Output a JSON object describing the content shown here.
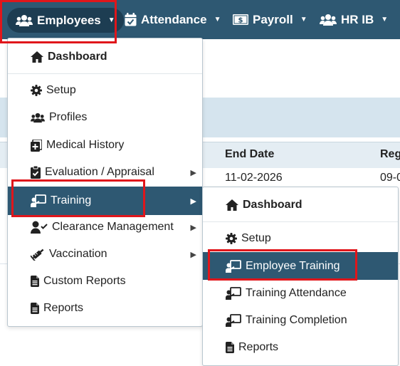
{
  "navbar": {
    "items": [
      {
        "label": "Employees",
        "icon": "users-icon"
      },
      {
        "label": "Attendance",
        "icon": "calendar-check-icon"
      },
      {
        "label": "Payroll",
        "icon": "money-bill-icon"
      },
      {
        "label": "HR IB",
        "icon": "users-icon"
      }
    ]
  },
  "background": {
    "columns": [
      "End Date",
      "Regi"
    ],
    "row": {
      "end_date": "11-02-2026",
      "regi": "09-0"
    }
  },
  "employees_menu": {
    "items": [
      {
        "label": "Dashboard",
        "icon": "home-icon"
      },
      {
        "label": "Setup",
        "icon": "gear-icon"
      },
      {
        "label": "Profiles",
        "icon": "users-icon"
      },
      {
        "label": "Medical History",
        "icon": "medical-file-icon"
      },
      {
        "label": "Evaluation / Appraisal",
        "icon": "clipboard-check-icon"
      },
      {
        "label": "Training",
        "icon": "chalkboard-teacher-icon"
      },
      {
        "label": "Clearance Management",
        "icon": "user-check-icon"
      },
      {
        "label": "Vaccination",
        "icon": "syringe-icon"
      },
      {
        "label": "Custom Reports",
        "icon": "file-icon"
      },
      {
        "label": "Reports",
        "icon": "file-icon"
      }
    ]
  },
  "training_menu": {
    "items": [
      {
        "label": "Dashboard",
        "icon": "home-icon"
      },
      {
        "label": "Setup",
        "icon": "gear-icon"
      },
      {
        "label": "Employee Training",
        "icon": "chalkboard-teacher-icon"
      },
      {
        "label": "Training Attendance",
        "icon": "chalkboard-teacher-icon"
      },
      {
        "label": "Training Completion",
        "icon": "chalkboard-teacher-icon"
      },
      {
        "label": "Reports",
        "icon": "file-icon"
      }
    ]
  },
  "colors": {
    "navbar": "#2e5872",
    "active_item": "#2e5872",
    "highlight": "#e0161b"
  }
}
